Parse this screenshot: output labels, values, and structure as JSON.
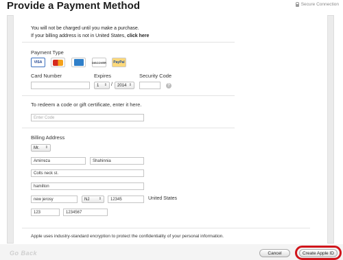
{
  "header": {
    "title": "Provide a Payment Method",
    "secure_label": "Secure Connection"
  },
  "notice": {
    "line1": "You will not be charged until you make a purchase.",
    "line2": "If your billing address is not in United States,",
    "line2_link": "click here"
  },
  "payment": {
    "type_label": "Payment Type",
    "cards": [
      "VISA",
      "MC",
      "AMEX",
      "DISCOVER",
      "PayPal"
    ],
    "selected_card": "VISA",
    "card_number_label": "Card Number",
    "card_number_value": "",
    "expires_label": "Expires",
    "expires_month": "1",
    "expires_year": "2014",
    "expires_sep": "/",
    "security_code_label": "Security Code",
    "security_code_value": "",
    "help_glyph": "?"
  },
  "redeem": {
    "label": "To redeem a code or gift certificate, enter it here.",
    "placeholder": "Enter Code"
  },
  "billing": {
    "label": "Billing Address",
    "title_value": "Mr.",
    "first_name": "Amirreza",
    "last_name": "Shahinnia",
    "street": "Colts neck st.",
    "city": "hamilton",
    "state_province": "new jerosy",
    "state": "NJ",
    "zip": "12345",
    "country": "United States",
    "area_code": "123",
    "phone": "1234567"
  },
  "footer": {
    "encryption_note": "Apple uses industry-standard encryption to protect the confidentiality of your personal information.",
    "cancel_label": "Cancel",
    "create_label": "Create Apple ID",
    "go_back_label": "Go Back"
  },
  "colors": {
    "highlight_ring": "#d0141a",
    "selected_card_border": "#3a6fbf"
  }
}
